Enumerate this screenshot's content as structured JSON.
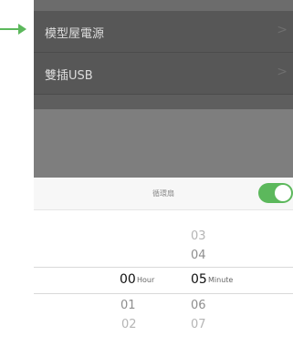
{
  "menu": {
    "items": [
      {
        "label": "模型屋電源",
        "chevron": ">"
      },
      {
        "label": "雙插USB",
        "chevron": ">"
      }
    ]
  },
  "picker": {
    "title": "循環扇",
    "toggle_on": true,
    "accent": "#5cb85c",
    "hours": {
      "above": [],
      "selected": "00",
      "below": [
        "01",
        "02"
      ]
    },
    "minutes": {
      "above": [
        "03",
        "04"
      ],
      "selected": "05",
      "below": [
        "06",
        "07"
      ]
    },
    "unit_hour": "Hour",
    "unit_minute": "Minute"
  },
  "annotation": {
    "arrow_color": "#5cb85c"
  }
}
